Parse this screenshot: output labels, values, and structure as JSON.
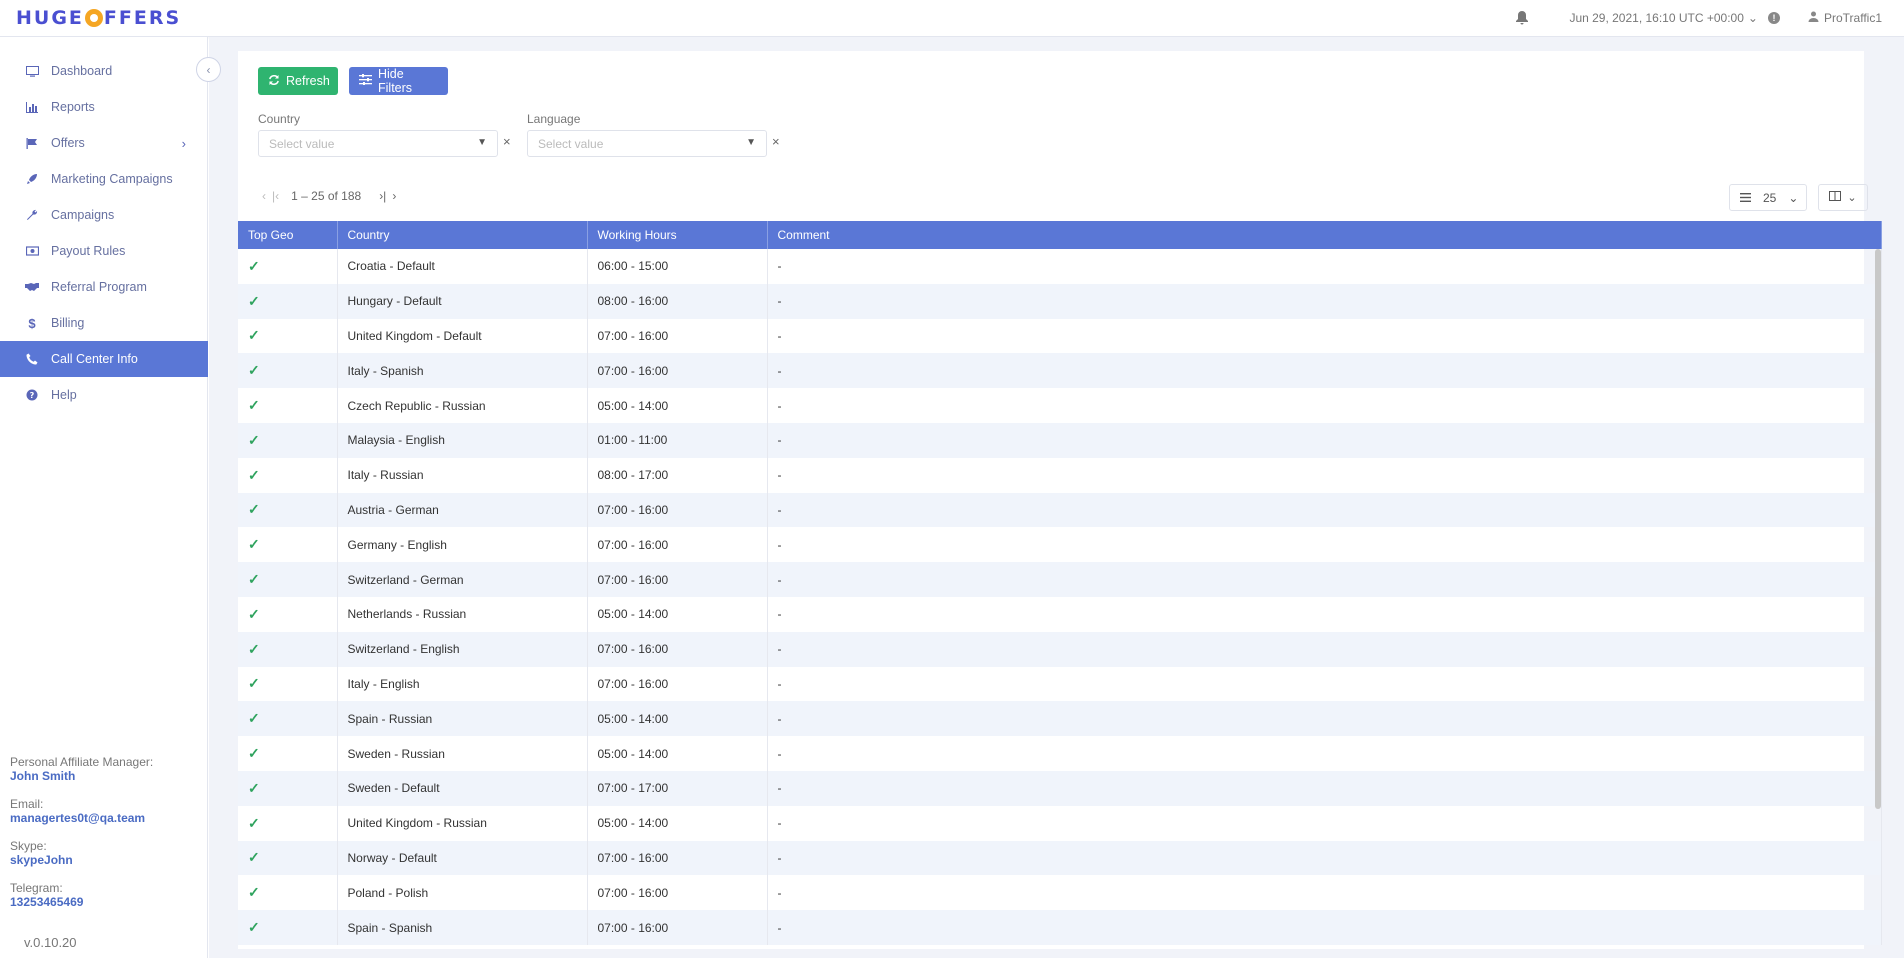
{
  "header": {
    "logo_left": "HUGE",
    "logo_right": "FFERS",
    "datetime": "Jun 29, 2021, 16:10 UTC +00:00",
    "username": "ProTraffic1"
  },
  "sidebar": {
    "items": [
      {
        "label": "Dashboard",
        "icon": "monitor-icon"
      },
      {
        "label": "Reports",
        "icon": "bar-chart-icon"
      },
      {
        "label": "Offers",
        "icon": "flag-icon"
      },
      {
        "label": "Marketing Campaigns",
        "icon": "rocket-icon"
      },
      {
        "label": "Campaigns",
        "icon": "wrench-icon"
      },
      {
        "label": "Payout Rules",
        "icon": "money-icon"
      },
      {
        "label": "Referral Program",
        "icon": "handshake-icon"
      },
      {
        "label": "Billing",
        "icon": "dollar-icon"
      },
      {
        "label": "Call Center Info",
        "icon": "phone-icon"
      },
      {
        "label": "Help",
        "icon": "help-icon"
      }
    ],
    "active_item": "Call Center Info",
    "manager": {
      "manager_label": "Personal Affiliate Manager:",
      "manager_name": "John Smith",
      "email_label": "Email:",
      "email": "managertes0t@qa.team",
      "skype_label": "Skype:",
      "skype": "skypeJohn",
      "telegram_label": "Telegram:",
      "telegram": "13253465469"
    },
    "version": "v.0.10.20"
  },
  "toolbar": {
    "refresh_label": "Refresh",
    "hide_filters_label": "Hide Filters"
  },
  "filters": {
    "country_label": "Country",
    "country_placeholder": "Select value",
    "language_label": "Language",
    "language_placeholder": "Select value",
    "clear_symbol": "×"
  },
  "pagination": {
    "range": "1 – 25 of 188",
    "per_page": "25"
  },
  "table": {
    "columns": [
      "Top Geo",
      "Country",
      "Working Hours",
      "Comment"
    ],
    "rows": [
      {
        "country": "Croatia - Default",
        "hours": "06:00 - 15:00",
        "comment": "-"
      },
      {
        "country": "Hungary - Default",
        "hours": "08:00 - 16:00",
        "comment": "-"
      },
      {
        "country": "United Kingdom - Default",
        "hours": "07:00 - 16:00",
        "comment": "-"
      },
      {
        "country": "Italy - Spanish",
        "hours": "07:00 - 16:00",
        "comment": "-"
      },
      {
        "country": "Czech Republic - Russian",
        "hours": "05:00 - 14:00",
        "comment": "-"
      },
      {
        "country": "Malaysia - English",
        "hours": "01:00 - 11:00",
        "comment": "-"
      },
      {
        "country": "Italy - Russian",
        "hours": "08:00 - 17:00",
        "comment": "-"
      },
      {
        "country": "Austria - German",
        "hours": "07:00 - 16:00",
        "comment": "-"
      },
      {
        "country": "Germany - English",
        "hours": "07:00 - 16:00",
        "comment": "-"
      },
      {
        "country": "Switzerland - German",
        "hours": "07:00 - 16:00",
        "comment": "-"
      },
      {
        "country": "Netherlands - Russian",
        "hours": "05:00 - 14:00",
        "comment": "-"
      },
      {
        "country": "Switzerland - English",
        "hours": "07:00 - 16:00",
        "comment": "-"
      },
      {
        "country": "Italy - English",
        "hours": "07:00 - 16:00",
        "comment": "-"
      },
      {
        "country": "Spain - Russian",
        "hours": "05:00 - 14:00",
        "comment": "-"
      },
      {
        "country": "Sweden - Russian",
        "hours": "05:00 - 14:00",
        "comment": "-"
      },
      {
        "country": "Sweden - Default",
        "hours": "07:00 - 17:00",
        "comment": "-"
      },
      {
        "country": "United Kingdom - Russian",
        "hours": "05:00 - 14:00",
        "comment": "-"
      },
      {
        "country": "Norway - Default",
        "hours": "07:00 - 16:00",
        "comment": "-"
      },
      {
        "country": "Poland - Polish",
        "hours": "07:00 - 16:00",
        "comment": "-"
      },
      {
        "country": "Spain - Spanish",
        "hours": "07:00 - 16:00",
        "comment": "-"
      }
    ]
  },
  "colors": {
    "accent": "#5a77d6",
    "success": "#2fb470",
    "logo": "#4a4fd1",
    "logo_o": "#f5a623"
  }
}
